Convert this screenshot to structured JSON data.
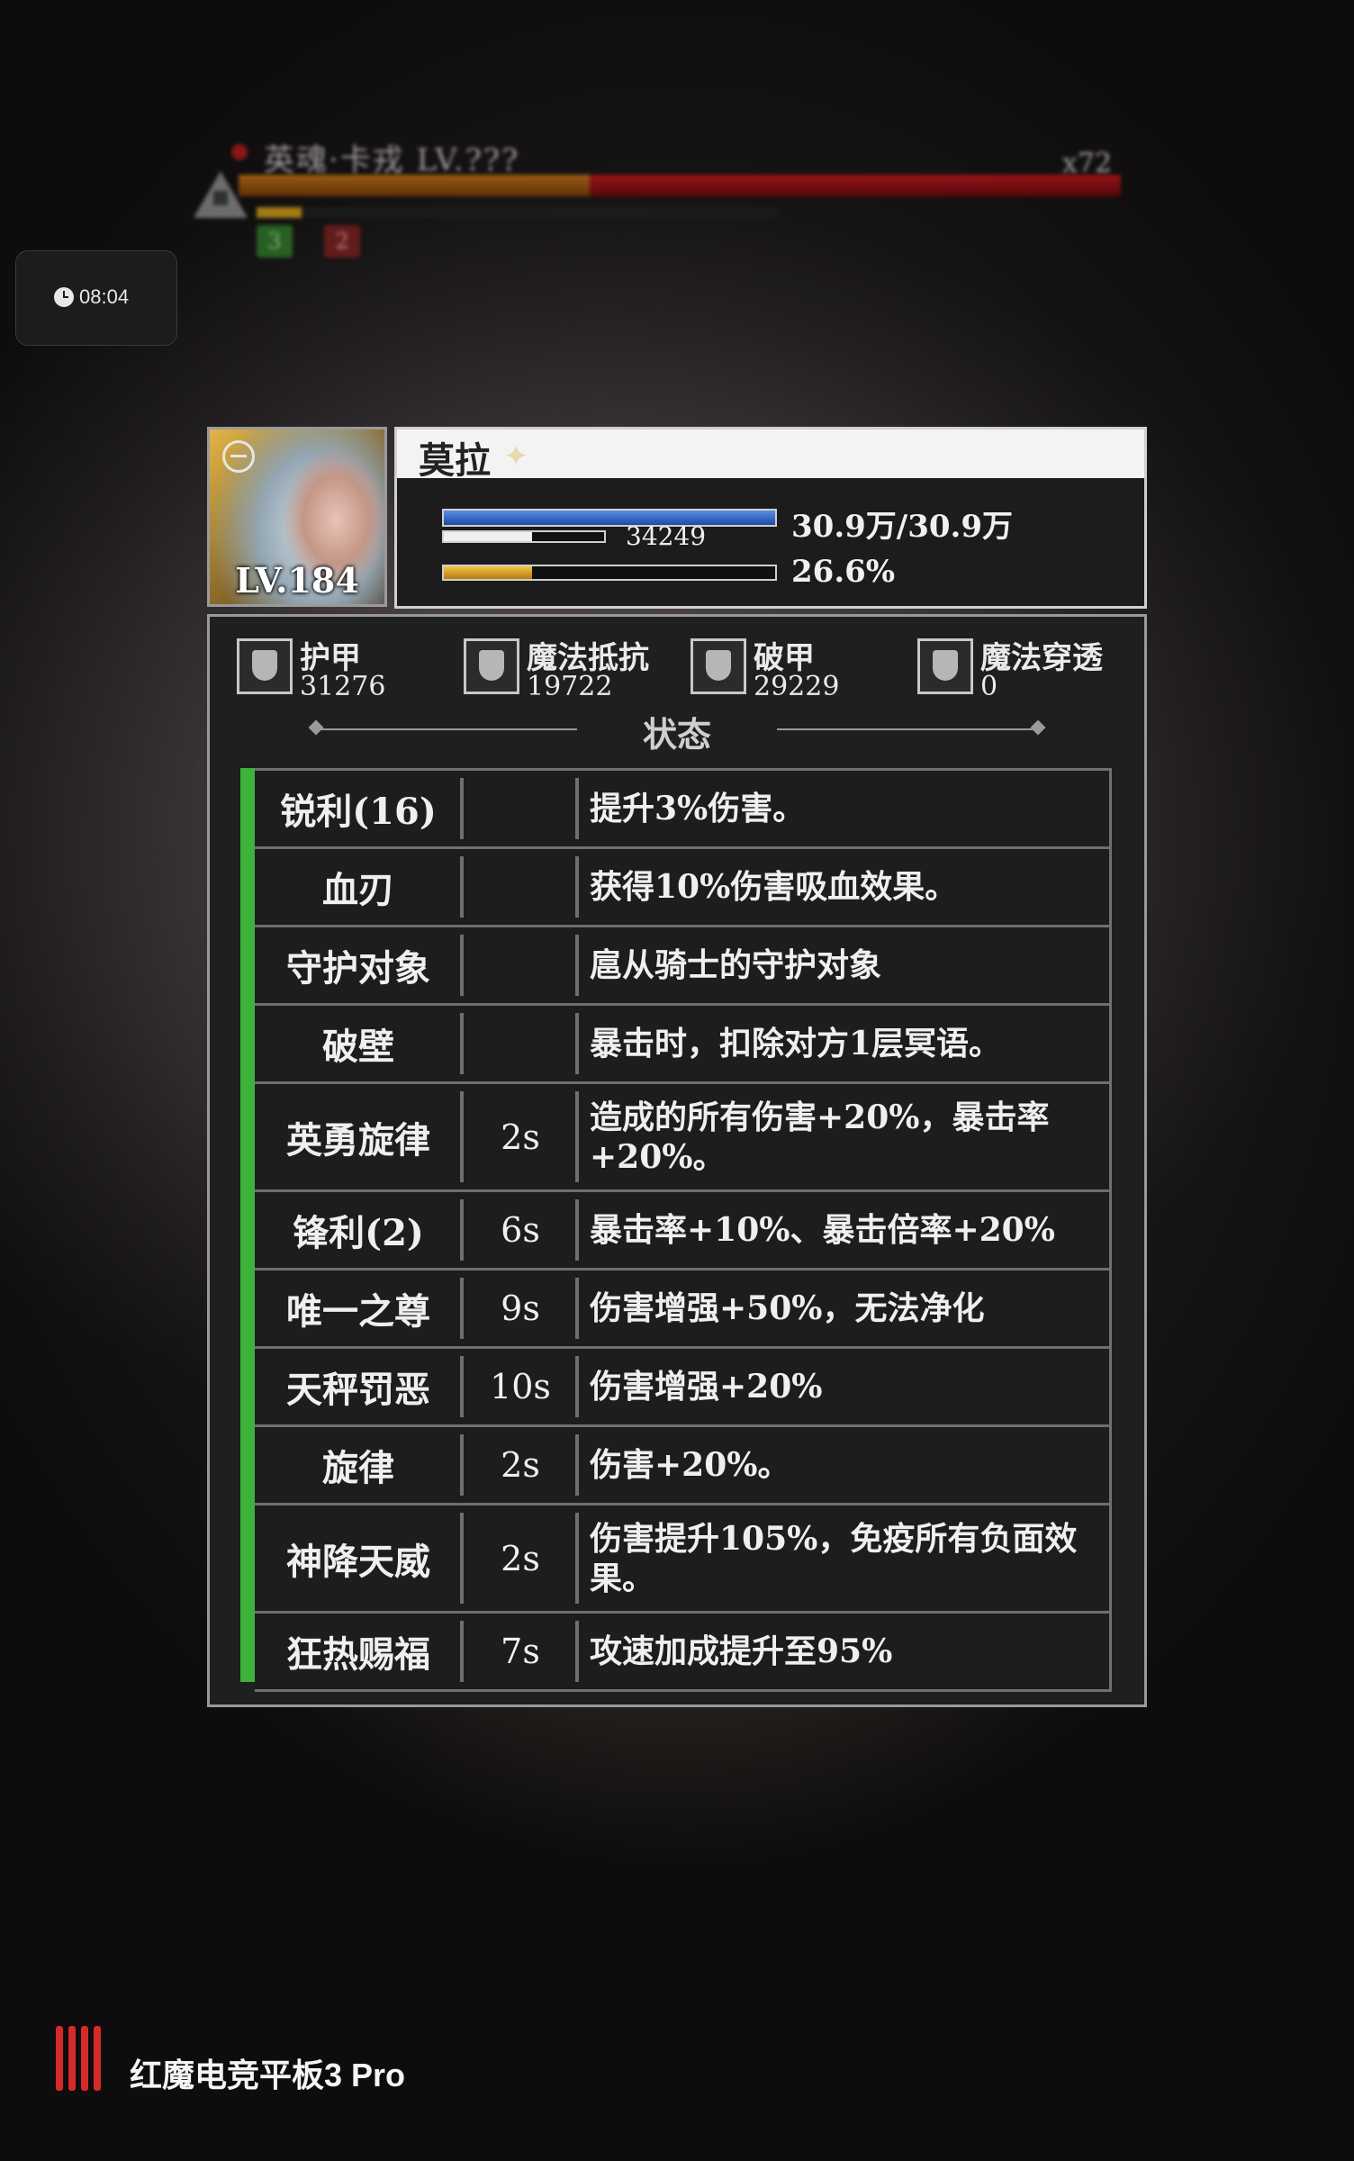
{
  "boss": {
    "name": "英魂·卡戎 LV.???",
    "count": "x72",
    "badge_green": "3",
    "badge_red": "2"
  },
  "timer": {
    "time": "08:04",
    "icon": "clock-icon"
  },
  "character": {
    "name": "莫拉",
    "level": "LV.184",
    "hp_text": "30.9万/30.9万",
    "shield_value": "34249",
    "energy_text": "26.6%",
    "energy_fraction": 0.266
  },
  "stats": [
    {
      "name": "护甲",
      "value": "31276",
      "icon": "armor-icon"
    },
    {
      "name": "魔法抵抗",
      "value": "19722",
      "icon": "magic-resist-icon"
    },
    {
      "name": "破甲",
      "value": "29229",
      "icon": "armor-break-icon"
    },
    {
      "name": "魔法穿透",
      "value": "0",
      "icon": "magic-pierce-icon"
    }
  ],
  "status_title": "状态",
  "buffs": [
    {
      "name": "锐利(16)",
      "time": "",
      "desc": "提升3%伤害。"
    },
    {
      "name": "血刃",
      "time": "",
      "desc": "获得10%伤害吸血效果。"
    },
    {
      "name": "守护对象",
      "time": "",
      "desc": "扈从骑士的守护对象"
    },
    {
      "name": "破壁",
      "time": "",
      "desc": "暴击时，扣除对方1层冥语。"
    },
    {
      "name": "英勇旋律",
      "time": "2s",
      "desc": "造成的所有伤害+20%，暴击率+20%。"
    },
    {
      "name": "锋利(2)",
      "time": "6s",
      "desc": "暴击率+10%、暴击倍率+20%"
    },
    {
      "name": "唯一之尊",
      "time": "9s",
      "desc": "伤害增强+50%，无法净化"
    },
    {
      "name": "天秤罚恶",
      "time": "10s",
      "desc": "伤害增强+20%"
    },
    {
      "name": "旋律",
      "time": "2s",
      "desc": "伤害+20%。"
    },
    {
      "name": "神降天威",
      "time": "2s",
      "desc": "伤害提升105%，免疫所有负面效果。"
    },
    {
      "name": "狂热赐福",
      "time": "7s",
      "desc": "攻速加成提升至95%"
    }
  ],
  "watermark": "红魔电竞平板3 Pro"
}
